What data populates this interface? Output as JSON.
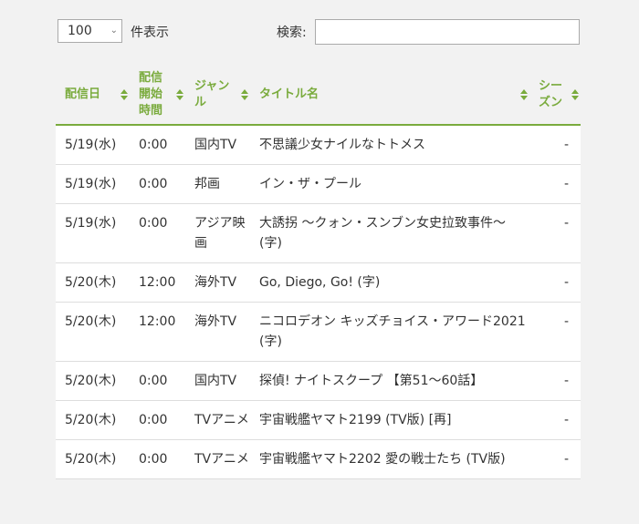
{
  "controls": {
    "length_value": "100",
    "length_label": "件表示",
    "search_label": "検索:",
    "search_value": ""
  },
  "table": {
    "columns": [
      "配信日",
      "配信開始時間",
      "ジャンル",
      "タイトル名",
      "シーズン"
    ],
    "column_lines": [
      [
        "配信日"
      ],
      [
        "配信",
        "開始",
        "時間"
      ],
      [
        "ジャン",
        "ル"
      ],
      [
        "タイトル名"
      ],
      [
        "シー",
        "ズン"
      ]
    ],
    "rows": [
      {
        "date": "5/19(水)",
        "time": "0:00",
        "genre": "国内TV",
        "title": "不思議少女ナイルなトトメス",
        "season": "-"
      },
      {
        "date": "5/19(水)",
        "time": "0:00",
        "genre": "邦画",
        "title": "イン・ザ・プール",
        "season": "-"
      },
      {
        "date": "5/19(水)",
        "time": "0:00",
        "genre": "アジア映画",
        "title": "大誘拐 ～クォン・スンブン女史拉致事件～ (字)",
        "season": "-"
      },
      {
        "date": "5/20(木)",
        "time": "12:00",
        "genre": "海外TV",
        "title": "Go, Diego, Go! (字)",
        "season": "-"
      },
      {
        "date": "5/20(木)",
        "time": "12:00",
        "genre": "海外TV",
        "title": "ニコロデオン キッズチョイス・アワード2021 (字)",
        "season": "-"
      },
      {
        "date": "5/20(木)",
        "time": "0:00",
        "genre": "国内TV",
        "title": "探偵! ナイトスクープ 【第51～60話】",
        "season": "-"
      },
      {
        "date": "5/20(木)",
        "time": "0:00",
        "genre": "TVアニメ",
        "title": "宇宙戦艦ヤマト2199 (TV版) [再]",
        "season": "-"
      },
      {
        "date": "5/20(木)",
        "time": "0:00",
        "genre": "TVアニメ",
        "title": "宇宙戦艦ヤマト2202 愛の戦士たち (TV版)",
        "season": "-"
      }
    ]
  },
  "colors": {
    "accent": "#7aab3d",
    "background": "#f2f2f2",
    "row_background": "#ffffff"
  },
  "icons": [
    "chevron-down-icon",
    "sort-icon"
  ]
}
